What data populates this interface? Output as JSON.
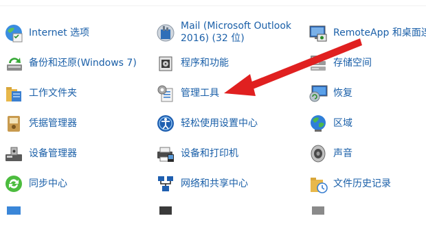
{
  "control_panel": {
    "items": [
      {
        "label": "Internet 选项",
        "icon": "internet-options-icon"
      },
      {
        "label": "Mail (Microsoft Outlook 2016) (32 位)",
        "icon": "mail-icon"
      },
      {
        "label": "RemoteApp 和桌面连",
        "icon": "remoteapp-icon"
      },
      {
        "label": "备份和还原(Windows 7)",
        "icon": "backup-restore-icon"
      },
      {
        "label": "程序和功能",
        "icon": "programs-features-icon"
      },
      {
        "label": "存储空间",
        "icon": "storage-spaces-icon"
      },
      {
        "label": "工作文件夹",
        "icon": "work-folders-icon"
      },
      {
        "label": "管理工具",
        "icon": "administrative-tools-icon"
      },
      {
        "label": "恢复",
        "icon": "recovery-icon"
      },
      {
        "label": "凭据管理器",
        "icon": "credential-manager-icon"
      },
      {
        "label": "轻松使用设置中心",
        "icon": "ease-of-access-icon"
      },
      {
        "label": "区域",
        "icon": "region-icon"
      },
      {
        "label": "设备管理器",
        "icon": "device-manager-icon"
      },
      {
        "label": "设备和打印机",
        "icon": "devices-printers-icon"
      },
      {
        "label": "声音",
        "icon": "sound-icon"
      },
      {
        "label": "同步中心",
        "icon": "sync-center-icon"
      },
      {
        "label": "网络和共享中心",
        "icon": "network-sharing-icon"
      },
      {
        "label": "文件历史记录",
        "icon": "file-history-icon"
      }
    ]
  },
  "annotation": {
    "arrow_color": "#e02020"
  },
  "colors": {
    "link": "#1a5fa8",
    "background": "#ffffff"
  }
}
